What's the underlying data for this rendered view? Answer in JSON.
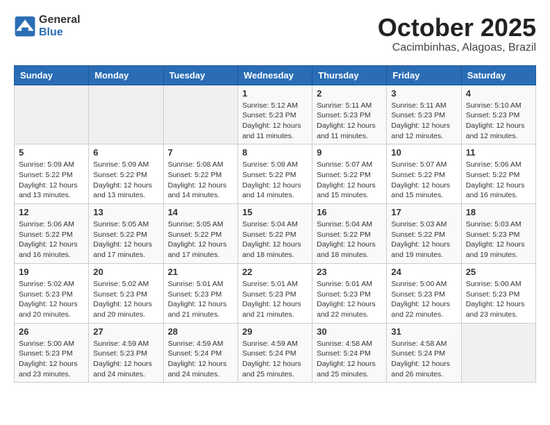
{
  "header": {
    "logo_general": "General",
    "logo_blue": "Blue",
    "month": "October 2025",
    "location": "Cacimbinhas, Alagoas, Brazil"
  },
  "weekdays": [
    "Sunday",
    "Monday",
    "Tuesday",
    "Wednesday",
    "Thursday",
    "Friday",
    "Saturday"
  ],
  "weeks": [
    [
      {
        "day": "",
        "empty": true
      },
      {
        "day": "",
        "empty": true
      },
      {
        "day": "",
        "empty": true
      },
      {
        "day": "1",
        "sunrise": "5:12 AM",
        "sunset": "5:23 PM",
        "daylight": "12 hours and 11 minutes."
      },
      {
        "day": "2",
        "sunrise": "5:11 AM",
        "sunset": "5:23 PM",
        "daylight": "12 hours and 11 minutes."
      },
      {
        "day": "3",
        "sunrise": "5:11 AM",
        "sunset": "5:23 PM",
        "daylight": "12 hours and 12 minutes."
      },
      {
        "day": "4",
        "sunrise": "5:10 AM",
        "sunset": "5:23 PM",
        "daylight": "12 hours and 12 minutes."
      }
    ],
    [
      {
        "day": "5",
        "sunrise": "5:09 AM",
        "sunset": "5:22 PM",
        "daylight": "12 hours and 13 minutes."
      },
      {
        "day": "6",
        "sunrise": "5:09 AM",
        "sunset": "5:22 PM",
        "daylight": "12 hours and 13 minutes."
      },
      {
        "day": "7",
        "sunrise": "5:08 AM",
        "sunset": "5:22 PM",
        "daylight": "12 hours and 14 minutes."
      },
      {
        "day": "8",
        "sunrise": "5:08 AM",
        "sunset": "5:22 PM",
        "daylight": "12 hours and 14 minutes."
      },
      {
        "day": "9",
        "sunrise": "5:07 AM",
        "sunset": "5:22 PM",
        "daylight": "12 hours and 15 minutes."
      },
      {
        "day": "10",
        "sunrise": "5:07 AM",
        "sunset": "5:22 PM",
        "daylight": "12 hours and 15 minutes."
      },
      {
        "day": "11",
        "sunrise": "5:06 AM",
        "sunset": "5:22 PM",
        "daylight": "12 hours and 16 minutes."
      }
    ],
    [
      {
        "day": "12",
        "sunrise": "5:06 AM",
        "sunset": "5:22 PM",
        "daylight": "12 hours and 16 minutes."
      },
      {
        "day": "13",
        "sunrise": "5:05 AM",
        "sunset": "5:22 PM",
        "daylight": "12 hours and 17 minutes."
      },
      {
        "day": "14",
        "sunrise": "5:05 AM",
        "sunset": "5:22 PM",
        "daylight": "12 hours and 17 minutes."
      },
      {
        "day": "15",
        "sunrise": "5:04 AM",
        "sunset": "5:22 PM",
        "daylight": "12 hours and 18 minutes."
      },
      {
        "day": "16",
        "sunrise": "5:04 AM",
        "sunset": "5:22 PM",
        "daylight": "12 hours and 18 minutes."
      },
      {
        "day": "17",
        "sunrise": "5:03 AM",
        "sunset": "5:22 PM",
        "daylight": "12 hours and 19 minutes."
      },
      {
        "day": "18",
        "sunrise": "5:03 AM",
        "sunset": "5:23 PM",
        "daylight": "12 hours and 19 minutes."
      }
    ],
    [
      {
        "day": "19",
        "sunrise": "5:02 AM",
        "sunset": "5:23 PM",
        "daylight": "12 hours and 20 minutes."
      },
      {
        "day": "20",
        "sunrise": "5:02 AM",
        "sunset": "5:23 PM",
        "daylight": "12 hours and 20 minutes."
      },
      {
        "day": "21",
        "sunrise": "5:01 AM",
        "sunset": "5:23 PM",
        "daylight": "12 hours and 21 minutes."
      },
      {
        "day": "22",
        "sunrise": "5:01 AM",
        "sunset": "5:23 PM",
        "daylight": "12 hours and 21 minutes."
      },
      {
        "day": "23",
        "sunrise": "5:01 AM",
        "sunset": "5:23 PM",
        "daylight": "12 hours and 22 minutes."
      },
      {
        "day": "24",
        "sunrise": "5:00 AM",
        "sunset": "5:23 PM",
        "daylight": "12 hours and 22 minutes."
      },
      {
        "day": "25",
        "sunrise": "5:00 AM",
        "sunset": "5:23 PM",
        "daylight": "12 hours and 23 minutes."
      }
    ],
    [
      {
        "day": "26",
        "sunrise": "5:00 AM",
        "sunset": "5:23 PM",
        "daylight": "12 hours and 23 minutes."
      },
      {
        "day": "27",
        "sunrise": "4:59 AM",
        "sunset": "5:23 PM",
        "daylight": "12 hours and 24 minutes."
      },
      {
        "day": "28",
        "sunrise": "4:59 AM",
        "sunset": "5:24 PM",
        "daylight": "12 hours and 24 minutes."
      },
      {
        "day": "29",
        "sunrise": "4:59 AM",
        "sunset": "5:24 PM",
        "daylight": "12 hours and 25 minutes."
      },
      {
        "day": "30",
        "sunrise": "4:58 AM",
        "sunset": "5:24 PM",
        "daylight": "12 hours and 25 minutes."
      },
      {
        "day": "31",
        "sunrise": "4:58 AM",
        "sunset": "5:24 PM",
        "daylight": "12 hours and 26 minutes."
      },
      {
        "day": "",
        "empty": true
      }
    ]
  ]
}
